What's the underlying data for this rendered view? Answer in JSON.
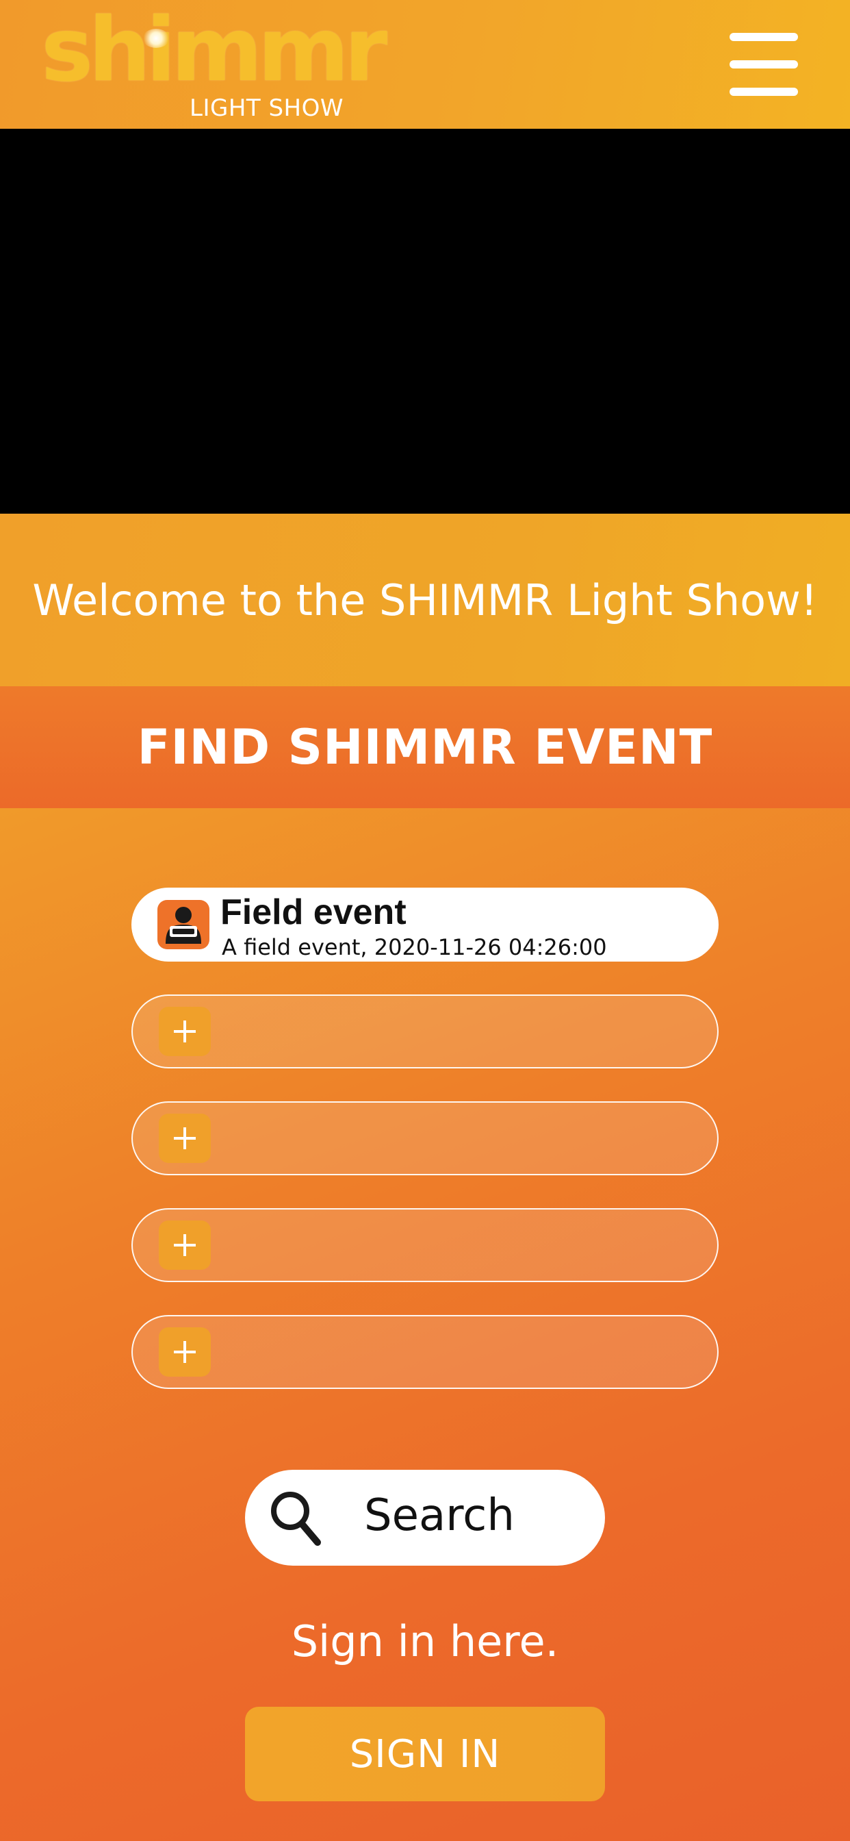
{
  "header": {
    "logo_text": "shimmr",
    "logo_subtitle": "LIGHT SHOW",
    "menu_icon": "hamburger-menu-icon"
  },
  "welcome": {
    "text": "Welcome to the SHIMMR Light Show!"
  },
  "find_section": {
    "title": "FIND SHIMMR EVENT",
    "events": [
      {
        "title": "Field event",
        "description": "A field event, 2020-11-26 04:26:00",
        "icon": "person-ticket-icon"
      }
    ],
    "empty_slots": [
      {
        "icon": "plus-icon"
      },
      {
        "icon": "plus-icon"
      },
      {
        "icon": "plus-icon"
      },
      {
        "icon": "plus-icon"
      }
    ]
  },
  "search": {
    "label": "Search",
    "icon": "search-icon"
  },
  "sign_in": {
    "hint": "Sign in here.",
    "button_label": "SIGN IN"
  },
  "colors": {
    "accent_orange": "#ec6a2a",
    "accent_amber": "#f0a02a",
    "logo_yellow": "#f6be2c",
    "white": "#ffffff",
    "black": "#000000"
  }
}
